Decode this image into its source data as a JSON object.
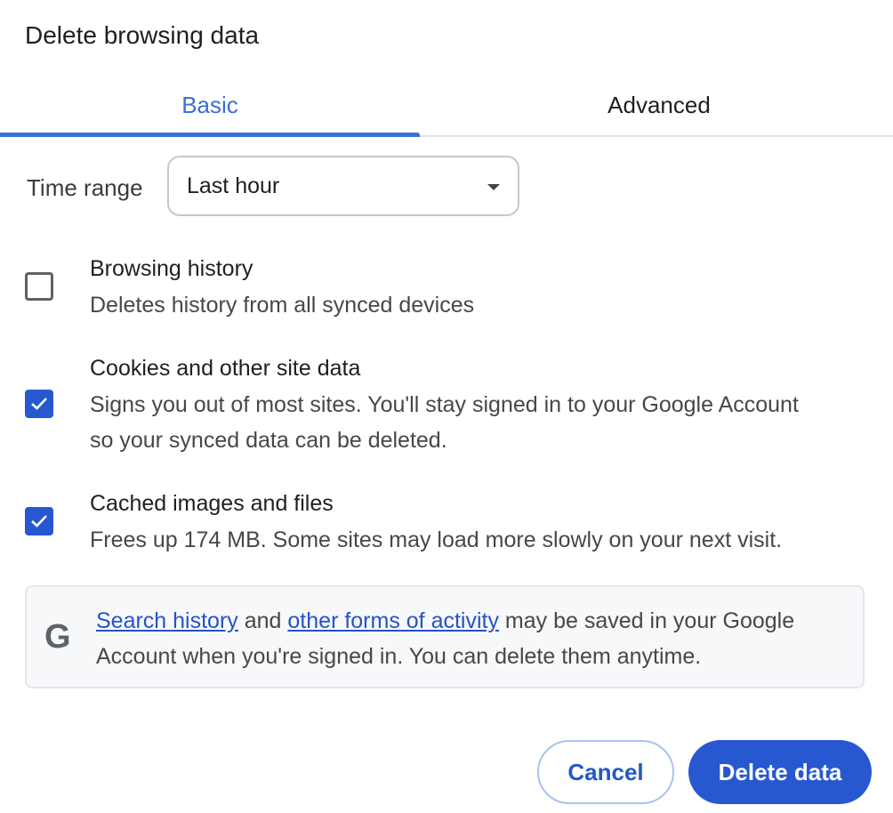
{
  "dialog": {
    "title": "Delete browsing data"
  },
  "tabs": [
    {
      "label": "Basic",
      "active": true
    },
    {
      "label": "Advanced",
      "active": false
    }
  ],
  "time_range": {
    "label": "Time range",
    "value": "Last hour"
  },
  "options": [
    {
      "title": "Browsing history",
      "description": "Deletes history from all synced devices",
      "checked": false
    },
    {
      "title": "Cookies and other site data",
      "description": "Signs you out of most sites. You'll stay signed in to your Google Account so your synced data can be deleted.",
      "checked": true
    },
    {
      "title": "Cached images and files",
      "description": "Frees up 174 MB. Some sites may load more slowly on your next visit.",
      "checked": true
    }
  ],
  "info": {
    "icon": "google-g-icon",
    "icon_glyph": "G",
    "link1": "Search history",
    "text1": " and ",
    "link2": "other forms of activity",
    "text2": " may be saved in your Google Account when you're signed in. You can delete them anytime."
  },
  "buttons": {
    "cancel": "Cancel",
    "delete": "Delete data"
  },
  "colors": {
    "accent": "#2858d0",
    "tab_active": "#3b6fd6",
    "link": "#2453c9"
  }
}
